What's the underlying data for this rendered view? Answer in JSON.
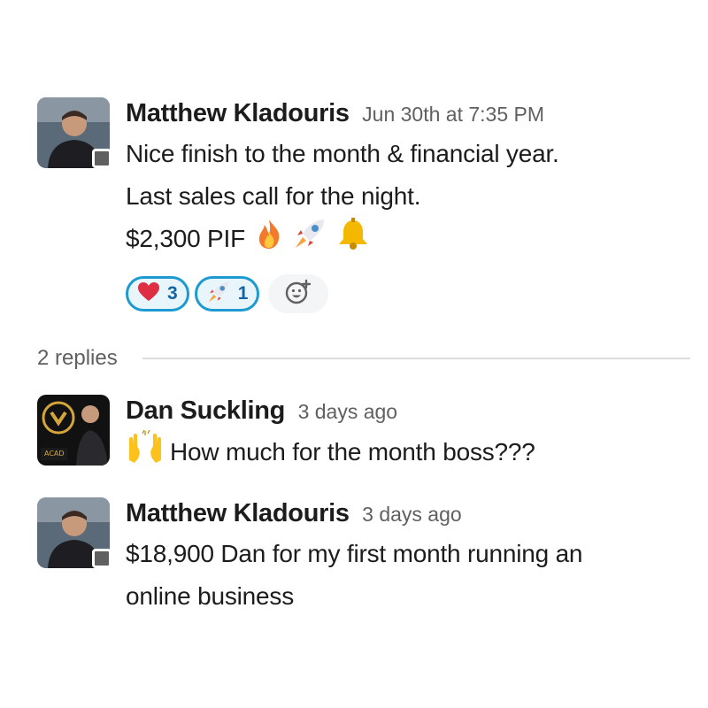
{
  "parent_message": {
    "author": "Matthew Kladouris",
    "timestamp": "Jun 30th at 7:35 PM",
    "lines": [
      "Nice finish to the month & financial year.",
      "Last sales call for the night.",
      "$2,300 PIF"
    ],
    "inline_emojis": [
      "fire",
      "rocket",
      "bell"
    ],
    "reactions": [
      {
        "emoji": "heart",
        "count": "3"
      },
      {
        "emoji": "rocket",
        "count": "1"
      }
    ],
    "add_reaction_icon": "add-reaction-icon",
    "presence_status": "away"
  },
  "thread": {
    "replies_label": "2 replies",
    "replies": [
      {
        "author": "Dan Suckling",
        "timestamp": "3 days ago",
        "emoji": "raising-hands",
        "text": "How much for the month boss???",
        "avatar_badge_text": "ACAD"
      },
      {
        "author": "Matthew Kladouris",
        "timestamp": "3 days ago",
        "lines": [
          "$18,900 Dan for my first month running an",
          "online business"
        ],
        "presence_status": "away"
      }
    ]
  },
  "colors": {
    "reaction_border": "#1d9bd1",
    "reaction_bg": "#e8f5fa",
    "reaction_count": "#1264a3",
    "timestamp": "#616061",
    "presence_away": "#616061"
  }
}
